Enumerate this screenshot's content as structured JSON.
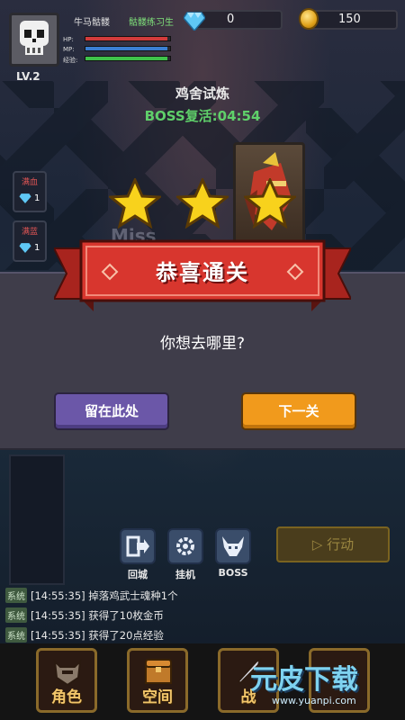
{
  "player": {
    "name": "牛马骷髅",
    "title": "骷髅练习生",
    "level": "LV.2",
    "hp_label": "HP:",
    "mp_label": "MP:",
    "exp_label": "经验:",
    "hp_fraction": 0.97,
    "mp_fraction": 0.97,
    "exp_fraction": 0.97
  },
  "resources": {
    "gems": "0",
    "gold": "150",
    "gem_icon": "diamond-icon",
    "gold_icon": "coin-icon"
  },
  "stage": {
    "name": "鸡舍试炼",
    "boss_timer": "BOSS复活:04:54"
  },
  "side_buttons": [
    {
      "label": "满血",
      "count": "1"
    },
    {
      "label": "满蓝",
      "count": "1"
    }
  ],
  "battle": {
    "miss_text": "Miss"
  },
  "dialog": {
    "banner": "恭喜通关",
    "stars_earned": 3,
    "question": "你想去哪里?",
    "stay_label": "留在此处",
    "next_label": "下一关"
  },
  "actions": [
    {
      "label": "回城",
      "icon": "exit-icon"
    },
    {
      "label": "挂机",
      "icon": "gear-icon"
    },
    {
      "label": "BOSS",
      "icon": "bull-head-icon"
    }
  ],
  "action_button": "▷ 行动",
  "log": [
    {
      "tag": "系统",
      "text": "[14:55:35] 掉落鸡武士魂种1个"
    },
    {
      "tag": "系统",
      "text": "[14:55:35] 获得了10枚金币"
    },
    {
      "tag": "系统",
      "text": "[14:55:35] 获得了20点经验"
    }
  ],
  "nav": [
    {
      "label": "角色",
      "icon": "helmet-icon"
    },
    {
      "label": "空间",
      "icon": "chest-icon"
    },
    {
      "label": "战",
      "icon": "sword-icon"
    }
  ],
  "watermark": {
    "text": "元皮下载",
    "url": "www.yuanpi.com"
  },
  "colors": {
    "hp": "#d23b3b",
    "mp": "#3b7fd2",
    "exp": "#3fc24a",
    "ribbon": "#d8362e",
    "stay_button": "#6b57a8",
    "next_button": "#f19a1c",
    "boss_timer": "#5fd06a"
  }
}
